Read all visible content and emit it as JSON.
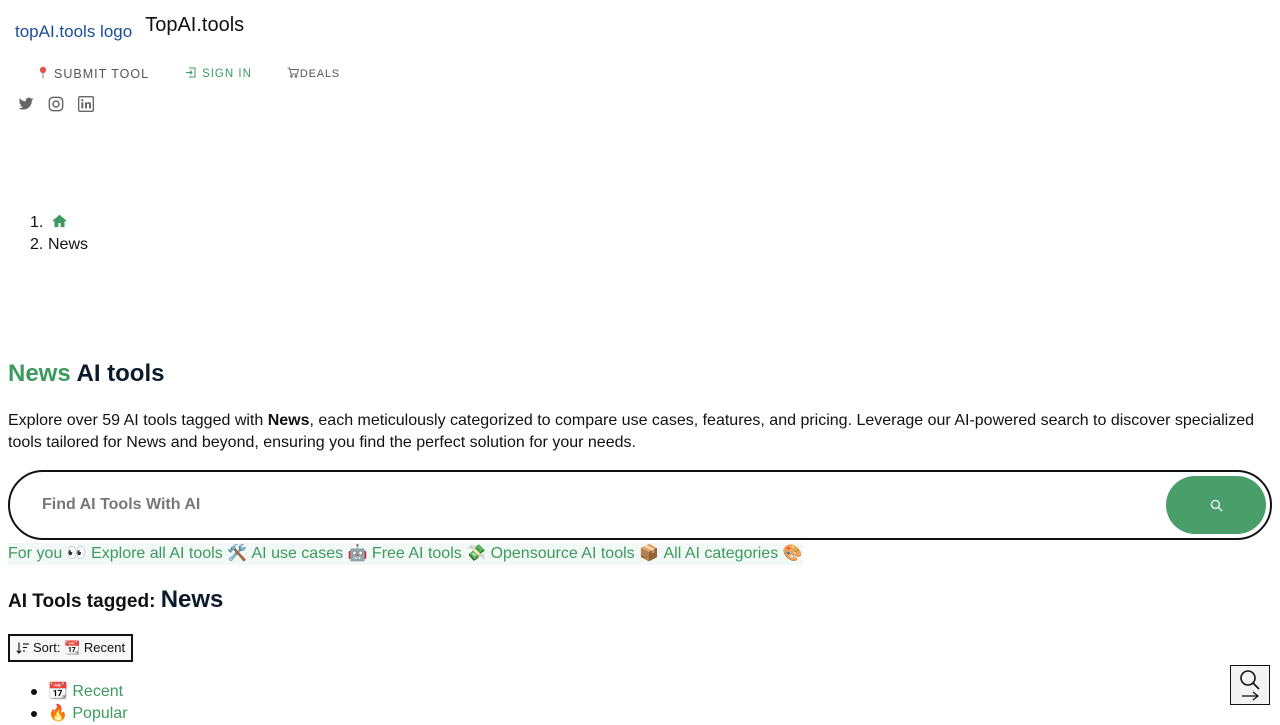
{
  "header": {
    "logo_alt": "topAI.tools logo",
    "site_name": "TopAI.tools",
    "nav": {
      "submit": "SUBMIT TOOL",
      "signin": "SIGN IN",
      "deals": "DEALS"
    },
    "social_icons": [
      "twitter-icon",
      "instagram-icon",
      "linkedin-icon"
    ]
  },
  "breadcrumb": {
    "items": [
      {
        "num": "1.",
        "icon": "home-icon"
      },
      {
        "num": "2.",
        "label": "News"
      }
    ]
  },
  "title": {
    "highlight": "News",
    "rest": " AI tools"
  },
  "description": {
    "before": "Explore over 59 AI tools tagged with ",
    "bold": "News",
    "after": ", each meticulously categorized to compare use cases, features, and pricing. Leverage our AI-powered search to discover specialized tools tailored for News and beyond, ensuring you find the perfect solution for your needs."
  },
  "search": {
    "placeholder": "Find AI Tools With AI"
  },
  "quicklinks": [
    "For you 👀 ",
    "Explore all AI tools 🛠️ ",
    "AI use cases 🤖 ",
    "Free AI tools 💸 ",
    "Opensource AI tools 📦 ",
    "All AI categories 🎨"
  ],
  "subtitle": {
    "prefix": "AI Tools tagged: ",
    "tag": "News"
  },
  "sort": {
    "label": "Sort: 📆 Recent",
    "options": [
      "📆 Recent",
      "🔥 Popular"
    ]
  },
  "colors": {
    "accent": "#3d9a5e",
    "button": "#4a9e6a",
    "quicklink_bg": "#f1f8f6"
  }
}
